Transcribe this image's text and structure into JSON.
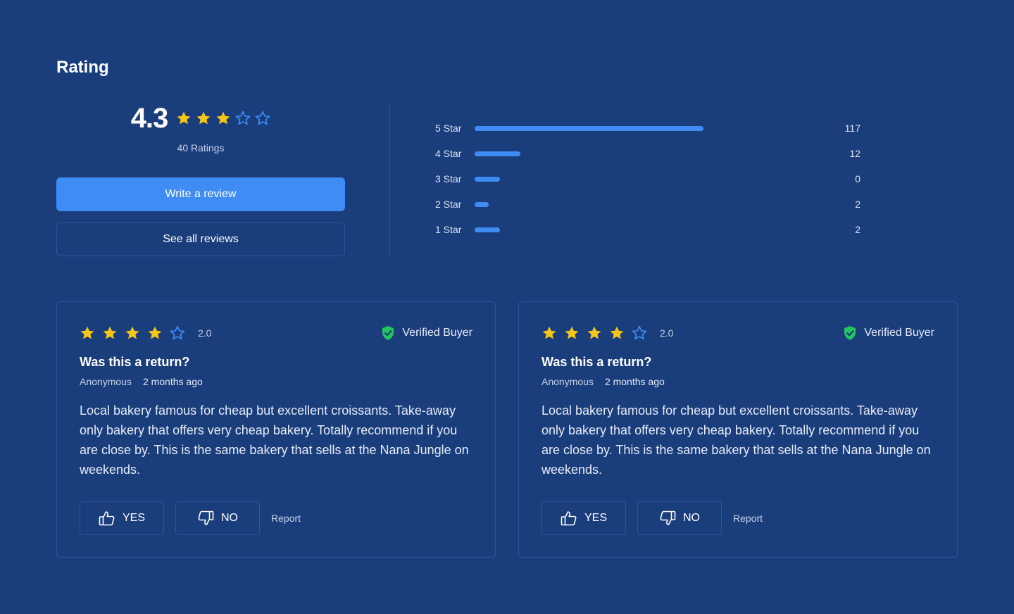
{
  "section_title": "Rating",
  "summary": {
    "score": "4.3",
    "stars_filled": 3,
    "stars_total": 5,
    "ratings_count": "40 Ratings",
    "write_review_label": "Write a review",
    "see_all_label": "See all reviews"
  },
  "breakdown": [
    {
      "label": "5 Star",
      "count": "117",
      "fill": 1.0
    },
    {
      "label": "4 Star",
      "count": "12",
      "fill": 0.2
    },
    {
      "label": "3 Star",
      "count": "0",
      "fill": 0.11
    },
    {
      "label": "2 Star",
      "count": "2",
      "fill": 0.06
    },
    {
      "label": "1 Star",
      "count": "2",
      "fill": 0.11
    }
  ],
  "reviews": [
    {
      "stars_filled": 4,
      "rating": "2.0",
      "verified_label": "Verified Buyer",
      "question": "Was this a return?",
      "author": "Anonymous",
      "time": "2 months ago",
      "body": "Local bakery famous for cheap but excellent croissants. Take-away only bakery that offers very cheap bakery. Totally recommend if you are close by. This is the same bakery that sells at the Nana Jungle on weekends.",
      "yes_label": "YES",
      "no_label": "NO",
      "report_label": "Report"
    },
    {
      "stars_filled": 4,
      "rating": "2.0",
      "verified_label": "Verified Buyer",
      "question": "Was this a return?",
      "author": "Anonymous",
      "time": "2 months ago",
      "body": "Local bakery famous for cheap but excellent croissants. Take-away only bakery that offers very cheap bakery. Totally recommend if you are close by. This is the same bakery that sells at the Nana Jungle on weekends.",
      "yes_label": "YES",
      "no_label": "NO",
      "report_label": "Report"
    }
  ],
  "colors": {
    "background": "#1a3d7c",
    "accent": "#3f8cf5",
    "star": "#f5c518",
    "verified": "#22c55e"
  },
  "icons": {
    "star_filled": "star-filled-icon",
    "star_empty": "star-outline-icon",
    "verified": "shield-check-icon",
    "yes": "thumbs-up-icon",
    "no": "thumbs-down-icon"
  }
}
